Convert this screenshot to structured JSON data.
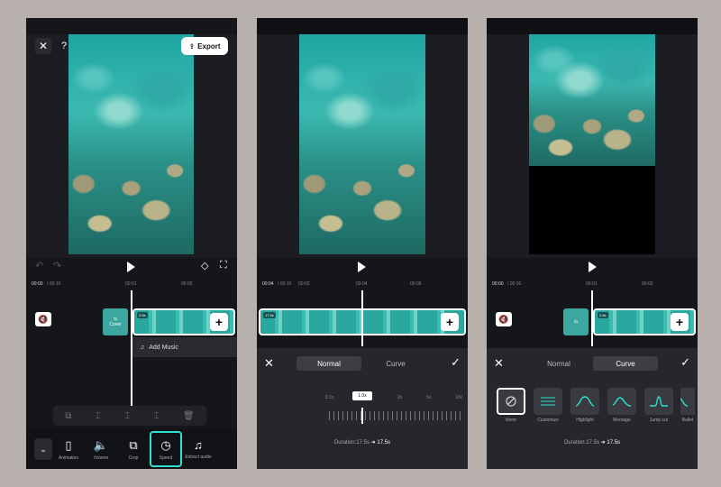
{
  "colors": {
    "accent": "#2de0d0",
    "background": "#b8b0ad",
    "panel": "#26272c"
  },
  "icons": [
    "close-icon",
    "help-icon",
    "export-icon",
    "undo-icon",
    "redo-icon",
    "keyframe-icon",
    "fullscreen-icon",
    "play-icon",
    "mute-icon",
    "add-icon",
    "music-icon",
    "check-icon",
    "chevron-down-icon"
  ],
  "screen1": {
    "export_label": "Export",
    "help": "?",
    "ruler": {
      "t0": "00:00",
      "t1": "/ 00:10",
      "m1": "00:01",
      "m2": "00:02"
    },
    "cover_label": "Cover",
    "strip_badge": "2.6s",
    "add_music": "Add Music",
    "tools": [
      {
        "label": "Animation",
        "icon": "▯"
      },
      {
        "label": "Volume",
        "icon": "🔈"
      },
      {
        "label": "Crop",
        "icon": "⧉"
      },
      {
        "label": "Speed",
        "icon": "◷"
      },
      {
        "label": "Extract audio",
        "icon": "♫"
      }
    ]
  },
  "screen2": {
    "ruler": {
      "t0": "00:04",
      "t1": "/ 00:10",
      "m1": "00:02",
      "m2": "00:04",
      "m3": "00:06"
    },
    "strip_badge": "17.5s",
    "tabs": {
      "normal": "Normal",
      "curve": "Curve"
    },
    "speed_marks": [
      "0.1x",
      "1x",
      "2x",
      "5x",
      "10x"
    ],
    "selected_speed": "1.0x",
    "duration_label": "Duration:17.5s",
    "duration_arrow": "➜",
    "duration_value": "17.5s"
  },
  "screen3": {
    "ruler": {
      "t0": "00:00",
      "t1": "/ 00:10",
      "m1": "00:01",
      "m2": "00:02"
    },
    "strip_badge": "2.6s",
    "tabs": {
      "normal": "Normal",
      "curve": "Curve"
    },
    "presets": [
      "None",
      "Customize",
      "Highlight",
      "Montage",
      "Jump cut",
      "Bullet"
    ],
    "duration_label": "Duration:17.5s",
    "duration_arrow": "➜",
    "duration_value": "17.5s"
  }
}
